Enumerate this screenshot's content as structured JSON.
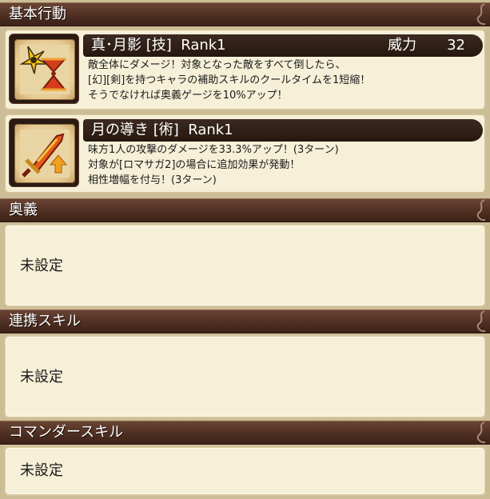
{
  "sections": {
    "basic": {
      "title": "基本行動"
    },
    "ougi": {
      "title": "奥義",
      "value": "未設定"
    },
    "renkei": {
      "title": "連携スキル",
      "value": "未設定"
    },
    "commander": {
      "title": "コマンダースキル",
      "value": "未設定"
    }
  },
  "skills": [
    {
      "name": "真･月影 [技]  Rank1",
      "power_label": "威力",
      "power_value": "32",
      "icon": "shuriken-hourglass-icon",
      "description": [
        "敵全体にダメージ！対象となった敵をすべて倒したら、",
        "[幻][剣]を持つキャラの補助スキルのクールタイムを1短縮！",
        "そうでなければ奥義ゲージを10%アップ！"
      ]
    },
    {
      "name": "月の導き [術]  Rank1",
      "icon": "flaming-sword-icon",
      "description": [
        "味方1人の攻撃のダメージを33.3%アップ！(3ターン)",
        "対象が[ロマサガ2]の場合に追加効果が発動！",
        "相性増幅を付与！(3ターン)"
      ]
    }
  ],
  "colors": {
    "header_bg": "#4e2f22",
    "panel_bg": "#f6f0d8",
    "page_bg": "#cdbd96"
  }
}
